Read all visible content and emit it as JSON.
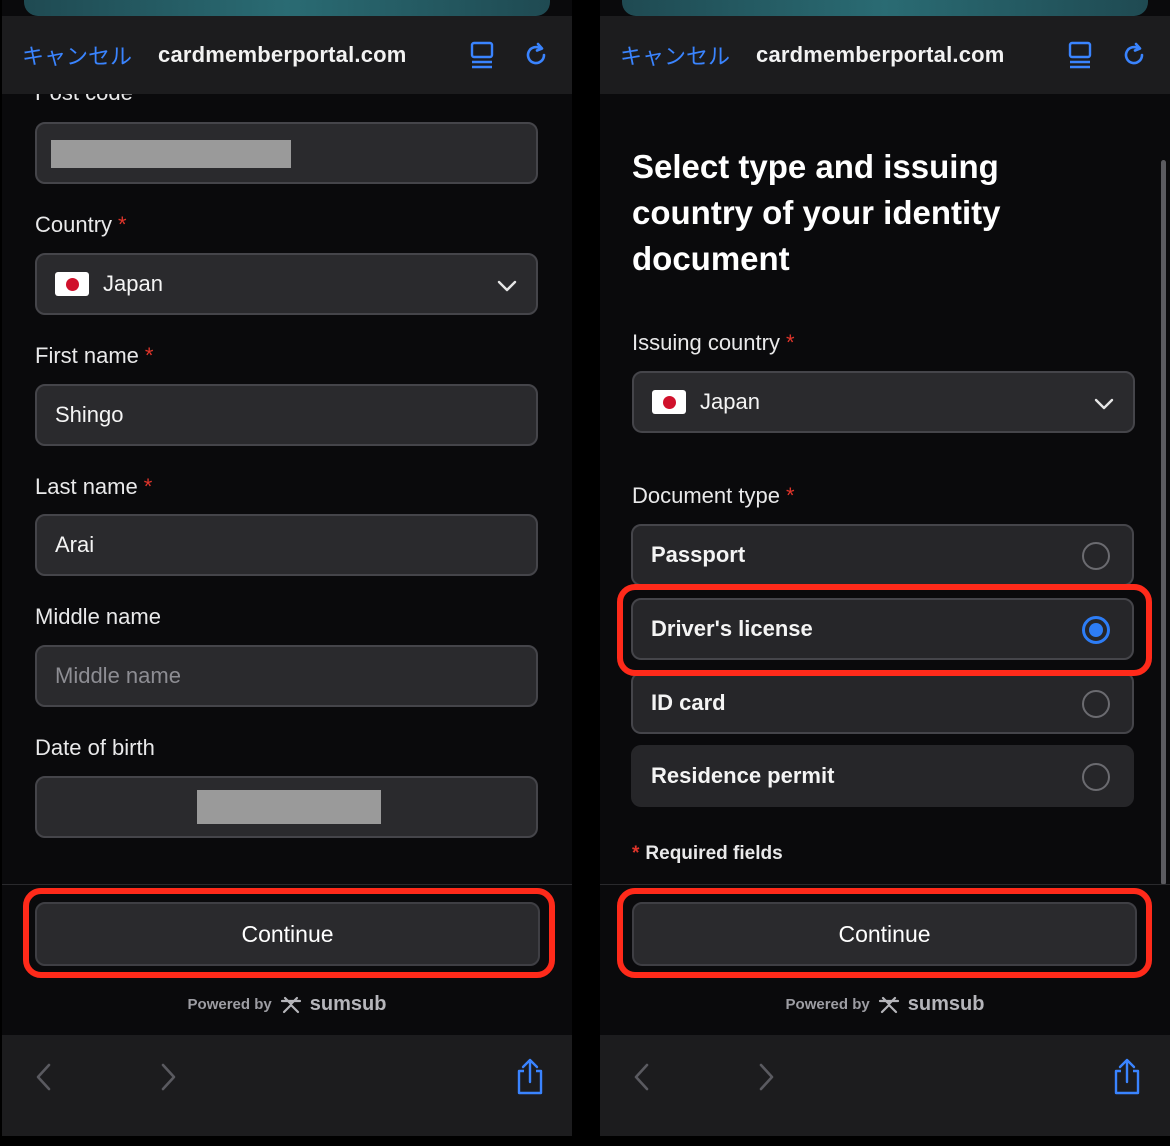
{
  "browser": {
    "cancel_label": "キャンセル",
    "url": "cardmemberportal.com"
  },
  "left": {
    "post_code_label": "Post code",
    "country": {
      "label": "Country",
      "value": "Japan"
    },
    "first_name": {
      "label": "First name",
      "value": "Shingo"
    },
    "last_name": {
      "label": "Last name",
      "value": "Arai"
    },
    "middle_name": {
      "label": "Middle name",
      "placeholder": "Middle name"
    },
    "dob": {
      "label": "Date of birth"
    },
    "continue_label": "Continue"
  },
  "right": {
    "title": "Select type and issuing country of your identity document",
    "issuing_country": {
      "label": "Issuing country",
      "value": "Japan"
    },
    "document_type_label": "Document type",
    "options": [
      {
        "label": "Passport",
        "selected": false
      },
      {
        "label": "Driver's license",
        "selected": true
      },
      {
        "label": "ID card",
        "selected": false
      },
      {
        "label": "Residence permit",
        "selected": false
      }
    ],
    "required_note": "Required fields",
    "continue_label": "Continue"
  },
  "footer": {
    "powered_by": "Powered by",
    "brand": "sumsub"
  },
  "required_marker": "*",
  "colors": {
    "accent_blue": "#2d7df6",
    "highlight_red": "#ff2a1a",
    "required_red": "#e0352b"
  }
}
